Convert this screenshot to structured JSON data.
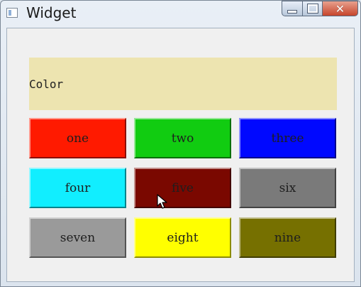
{
  "window": {
    "title": "Widget",
    "close_glyph": "✕"
  },
  "label": {
    "text": "Color",
    "background": "#ede4b0"
  },
  "buttons": [
    {
      "label": "one",
      "color": "#ff1a00"
    },
    {
      "label": "two",
      "color": "#11cc11"
    },
    {
      "label": "three",
      "color": "#0008ff"
    },
    {
      "label": "four",
      "color": "#11eeff"
    },
    {
      "label": "five",
      "color": "#7a0800"
    },
    {
      "label": "six",
      "color": "#7a7a7a"
    },
    {
      "label": "seven",
      "color": "#9a9a9a"
    },
    {
      "label": "eight",
      "color": "#ffff00"
    },
    {
      "label": "nine",
      "color": "#767000"
    }
  ],
  "icons": {
    "app": "window-app-icon",
    "minimize": "minimize-icon",
    "maximize": "maximize-icon",
    "close": "close-icon",
    "cursor": "mouse-cursor-icon"
  }
}
